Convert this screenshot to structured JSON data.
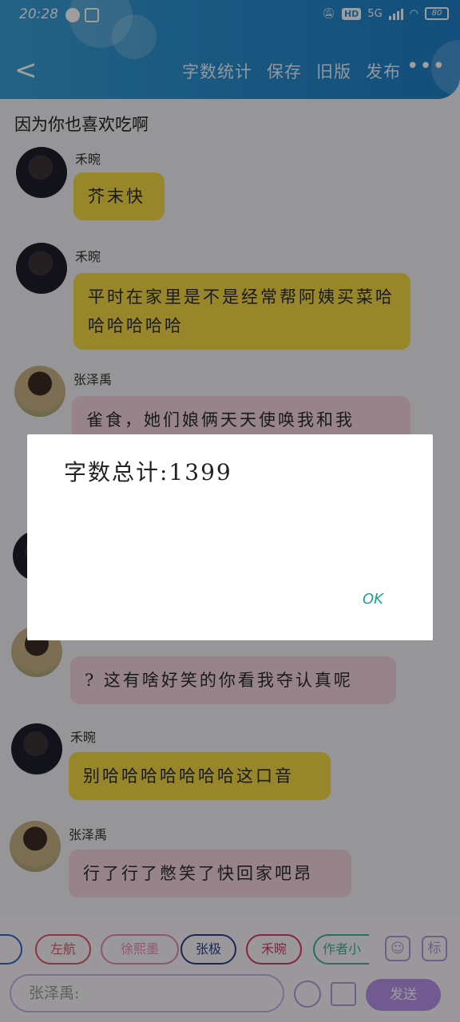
{
  "status": {
    "time": "20:28",
    "hd": "HD",
    "net": "5G",
    "battery": "80"
  },
  "nav": {
    "back": "<",
    "menu": [
      "字数统计",
      "保存",
      "旧版",
      "发布"
    ],
    "more": "•••"
  },
  "topic": "因为你也喜欢吃啊",
  "messages": [
    {
      "name": "禾晼",
      "text": "芥末快",
      "color": "yellow"
    },
    {
      "name": "禾晼",
      "text": "平时在家里是不是经常帮阿姨买菜哈哈哈哈哈哈",
      "color": "yellow"
    },
    {
      "name": "张泽禹",
      "text": "雀食，她们娘俩天天使唤我和我",
      "color": "pink"
    },
    {
      "name": "",
      "text": "? 这有啥好笑的你看我夺认真呢",
      "color": "pink"
    },
    {
      "name": "禾晼",
      "text": "别哈哈哈哈哈哈哈这口音",
      "color": "yellow"
    },
    {
      "name": "张泽禹",
      "text": "行了行了憋笑了快回家吧昂",
      "color": "pink"
    }
  ],
  "chips": [
    {
      "label": "左航",
      "color": "#e0566b"
    },
    {
      "label": "徐熙墨",
      "color": "#e58bb6"
    },
    {
      "label": "张极",
      "color": "#2b3f8c"
    },
    {
      "label": "禾晼",
      "color": "#d63a66"
    },
    {
      "label": "作者小",
      "color": "#3ab39a"
    }
  ],
  "bottom": {
    "sq1": "☺",
    "sq2": "标",
    "input_placeholder": "张泽禹:",
    "send": "发送"
  },
  "dialog": {
    "text": "字数总计:1399",
    "ok": "OK"
  }
}
